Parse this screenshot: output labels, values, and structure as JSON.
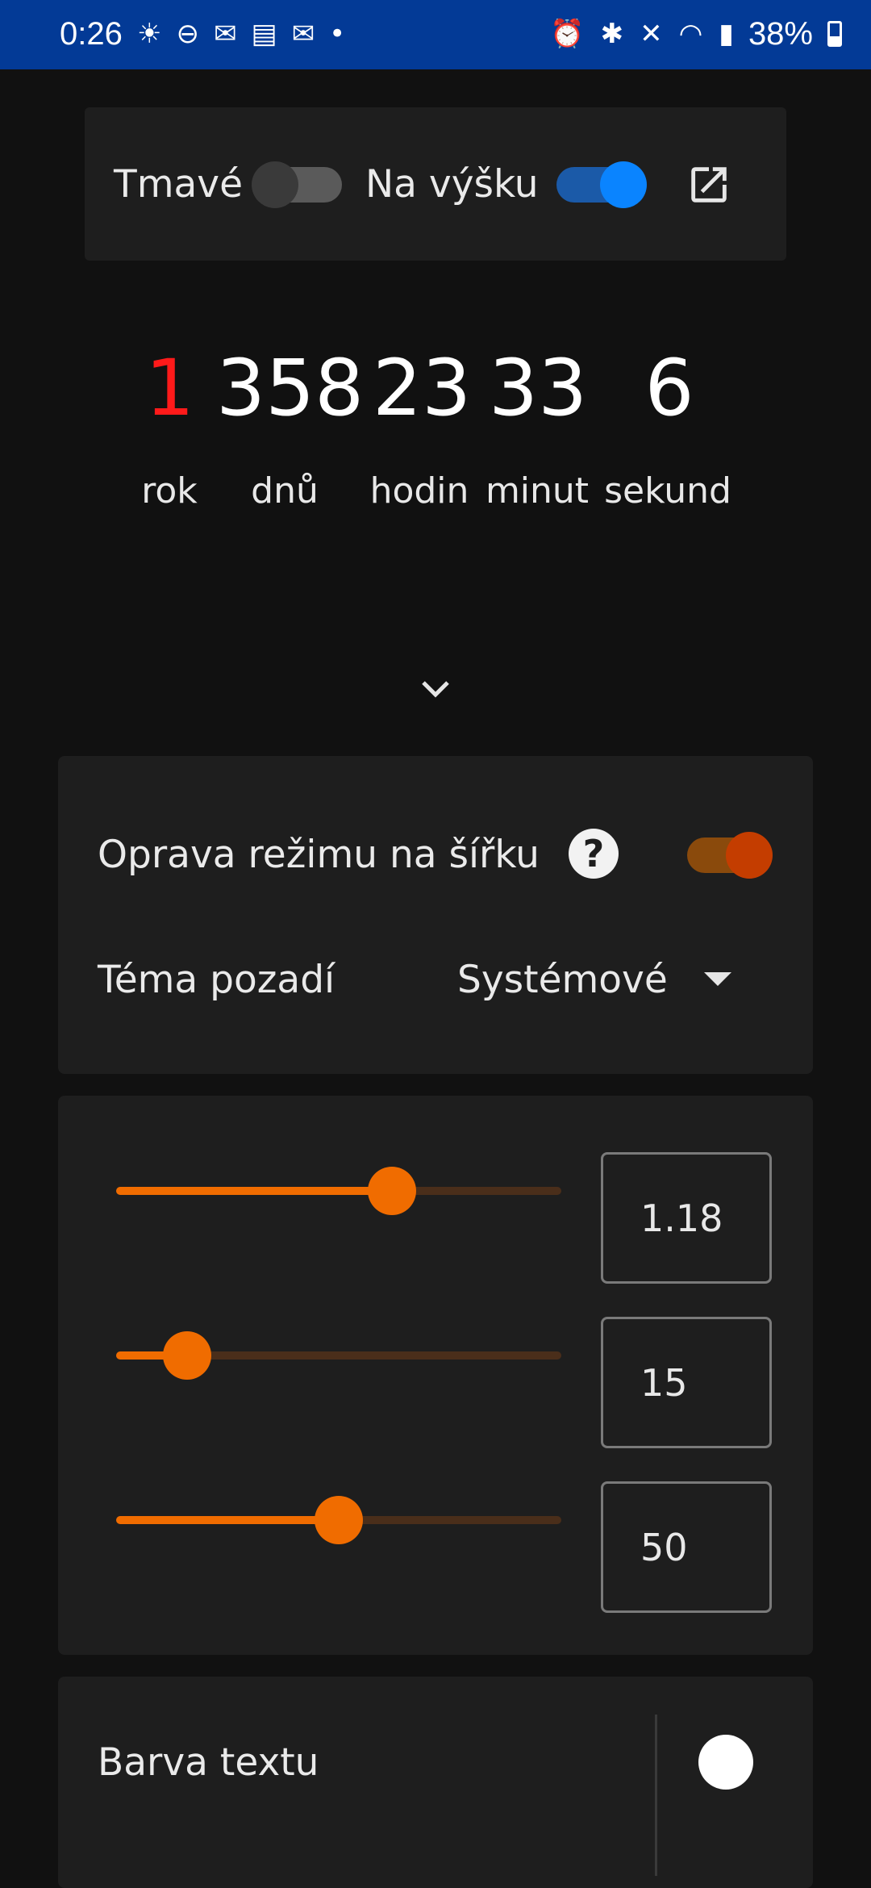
{
  "status_bar": {
    "time": "0:26",
    "left_icons": [
      "weather-icon",
      "dnd-icon",
      "mail-icon",
      "sim-icon",
      "message-icon",
      "dot-icon"
    ],
    "right_icons": [
      "alarm-icon",
      "bluetooth-icon",
      "mute-icon",
      "wifi-icon",
      "signal-icon"
    ],
    "battery": "38%",
    "background": "#033a96"
  },
  "top_panel": {
    "dark_label": "Tmavé",
    "dark_on": false,
    "portrait_label": "Na výšku",
    "portrait_on": true,
    "open_icon": "open-in-new-icon"
  },
  "countdown": [
    {
      "value": "1",
      "unit": "rok",
      "color": "#ff1a1a"
    },
    {
      "value": "358",
      "unit": "dnů",
      "color": "#ffffff"
    },
    {
      "value": "23",
      "unit": "hodin",
      "color": "#ffffff"
    },
    {
      "value": "33",
      "unit": "minut",
      "color": "#ffffff"
    },
    {
      "value": "6",
      "unit": "sekund",
      "color": "#ffffff"
    }
  ],
  "expand_icon": "chevron-down-icon",
  "settings": {
    "landscape_fix_label": "Oprava režimu na šířku",
    "landscape_fix_on": true,
    "help_glyph": "?",
    "theme_label": "Téma pozadí",
    "theme_value": "Systémové"
  },
  "sliders": [
    {
      "value_text": "1.18",
      "level": 0.62
    },
    {
      "value_text": "15",
      "level": 0.16
    },
    {
      "value_text": "50",
      "level": 0.5
    }
  ],
  "text_color": {
    "label": "Barva textu",
    "swatch": "#ffffff"
  },
  "accent": "#f06c00"
}
